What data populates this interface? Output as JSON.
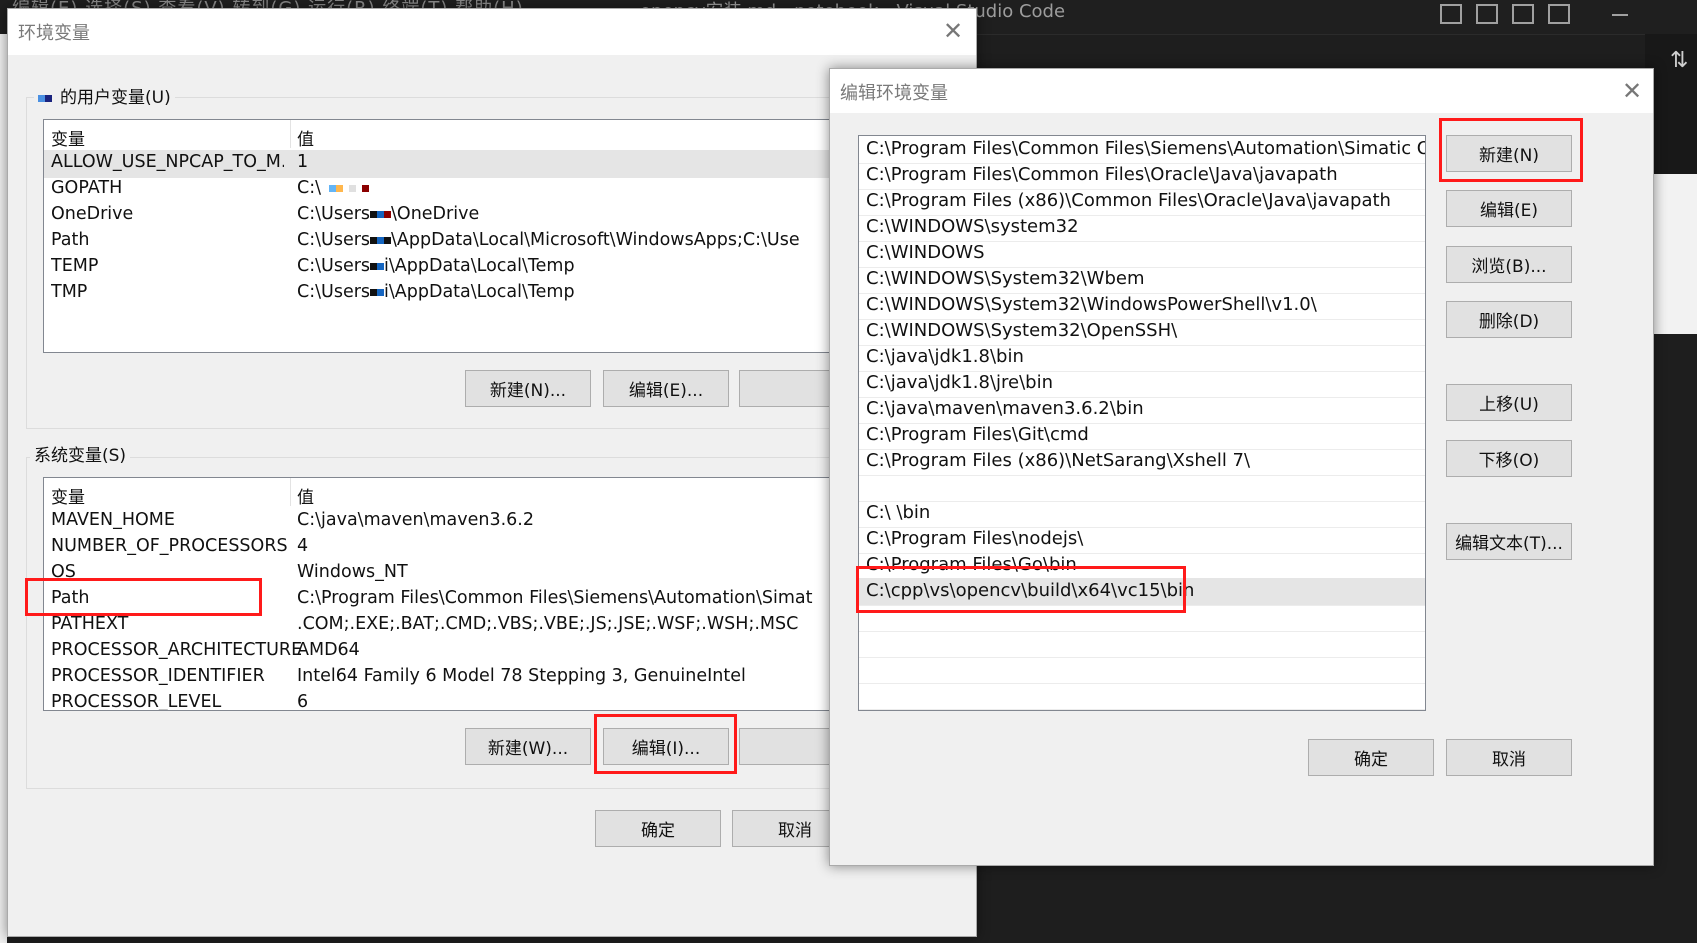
{
  "vscode": {
    "menu_text": "编辑(E)  选择(S)  查看(V)  转到(G)  运行(R)  终端(T)  帮助(H)",
    "window_title": "opencv安装.md - notebook - Visual Studio Code",
    "right_icon": "source-control-icon"
  },
  "env_dialog": {
    "title": "环境变量",
    "close_glyph": "✕",
    "user_group_label": "的用户变量(U)",
    "user_columns": [
      "变量",
      "值"
    ],
    "user_vars": [
      {
        "name": "ALLOW_USE_NPCAP_TO_M...",
        "value": "1"
      },
      {
        "name": "GOPATH",
        "value": "C:\\"
      },
      {
        "name": "OneDrive",
        "value": "C:\\Users",
        "value_suffix": "\\OneDrive"
      },
      {
        "name": "Path",
        "value": "C:\\Users",
        "value_suffix": "\\AppData\\Local\\Microsoft\\WindowsApps;C:\\Use"
      },
      {
        "name": "TEMP",
        "value": "C:\\Users",
        "value_suffix": "i\\AppData\\Local\\Temp"
      },
      {
        "name": "TMP",
        "value": "C:\\Users",
        "value_suffix": "i\\AppData\\Local\\Temp"
      }
    ],
    "user_buttons": {
      "new": "新建(N)...",
      "edit": "编辑(E)..."
    },
    "system_group_label": "系统变量(S)",
    "system_columns": [
      "变量",
      "值"
    ],
    "system_vars": [
      {
        "name": "MAVEN_HOME",
        "value": "C:\\java\\maven\\maven3.6.2"
      },
      {
        "name": "NUMBER_OF_PROCESSORS",
        "value": "4"
      },
      {
        "name": "OS",
        "value": "Windows_NT"
      },
      {
        "name": "Path",
        "value": "C:\\Program Files\\Common Files\\Siemens\\Automation\\Simat"
      },
      {
        "name": "PATHEXT",
        "value": ".COM;.EXE;.BAT;.CMD;.VBS;.VBE;.JS;.JSE;.WSF;.WSH;.MSC"
      },
      {
        "name": "PROCESSOR_ARCHITECTURE",
        "value": "AMD64"
      },
      {
        "name": "PROCESSOR_IDENTIFIER",
        "value": "Intel64 Family 6 Model 78 Stepping 3, GenuineIntel"
      },
      {
        "name": "PROCESSOR_LEVEL",
        "value": "6"
      }
    ],
    "system_buttons": {
      "new": "新建(W)...",
      "edit": "编辑(I)..."
    },
    "ok": "确定",
    "cancel": "取消"
  },
  "edit_dialog": {
    "title": "编辑环境变量",
    "close_glyph": "✕",
    "paths": [
      "C:\\Program Files\\Common Files\\Siemens\\Automation\\Simatic OAM\\...",
      "C:\\Program Files\\Common Files\\Oracle\\Java\\javapath",
      "C:\\Program Files (x86)\\Common Files\\Oracle\\Java\\javapath",
      "C:\\WINDOWS\\system32",
      "C:\\WINDOWS",
      "C:\\WINDOWS\\System32\\Wbem",
      "C:\\WINDOWS\\System32\\WindowsPowerShell\\v1.0\\",
      "C:\\WINDOWS\\System32\\OpenSSH\\",
      "C:\\java\\jdk1.8\\bin",
      "C:\\java\\jdk1.8\\jre\\bin",
      "C:\\java\\maven\\maven3.6.2\\bin",
      "C:\\Program Files\\Git\\cmd",
      "C:\\Program Files (x86)\\NetSarang\\Xshell 7\\",
      "",
      "C:\\       \\bin",
      "C:\\Program Files\\nodejs\\",
      "C:\\Program Files\\Go\\bin",
      "C:\\cpp\\vs\\opencv\\build\\x64\\vc15\\bin"
    ],
    "buttons": {
      "new": "新建(N)",
      "edit": "编辑(E)",
      "browse": "浏览(B)...",
      "delete": "删除(D)",
      "up": "上移(U)",
      "down": "下移(O)",
      "edit_text": "编辑文本(T)..."
    },
    "ok": "确定",
    "cancel": "取消"
  },
  "colors": {
    "highlight_box": "#ff1a1a",
    "dialog_bg": "#f0f0f0",
    "selected_row": "#e5e5e5"
  }
}
